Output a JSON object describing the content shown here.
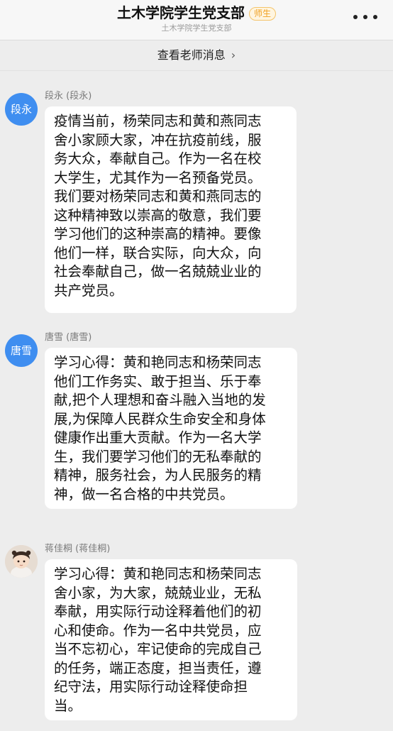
{
  "header": {
    "title": "土木学院学生党支部",
    "badge": "师生",
    "subtitle": "土木学院学生党支部"
  },
  "notice": {
    "label": "查看老师消息",
    "chevron": "›"
  },
  "messages": [
    {
      "avatar_text": "段永",
      "sender": "段永 (段永)",
      "text": "疫情当前，杨荣同志和黄和燕同志\n舍小家顾大家，冲在抗疫前线，服\n务大众，奉献自己。作为一名在校\n大学生，尤其作为一名预备党员。\n我们要对杨荣同志和黄和燕同志的\n这种精神致以崇高的敬意，我们要\n学习他们的这种崇高的精神。要像\n他们一样，联合实际，向大众，向\n社会奉献自己，做一名兢兢业业的\n共产党员。"
    },
    {
      "avatar_text": "唐雪",
      "sender": "唐雪 (唐雪)",
      "text": "学习心得：黄和艳同志和杨荣同志\n他们工作务实、敢于担当、乐于奉\n献,把个人理想和奋斗融入当地的发\n展,为保障人民群众生命安全和身体\n健康作出重大贡献。作为一名大学\n生，我们要学习他们的无私奉献的\n精神，服务社会，为人民服务的精\n神，做一名合格的中共党员。"
    },
    {
      "avatar_text": "",
      "sender": "蒋佳桐 (蒋佳桐)",
      "text": "学习心得：黄和艳同志和杨荣同志\n舍小家，为大家，兢兢业业，无私\n奉献，用实际行动诠释着他们的初\n心和使命。作为一名中共党员，应\n当不忘初心，牢记使命的完成自己\n的任务，端正态度，担当责任，遵\n纪守法，用实际行动诠释使命担\n当。"
    }
  ],
  "colors": {
    "avatar_blue": "#3f8ef0",
    "badge_orange": "#f0a020",
    "background": "#ededed"
  }
}
